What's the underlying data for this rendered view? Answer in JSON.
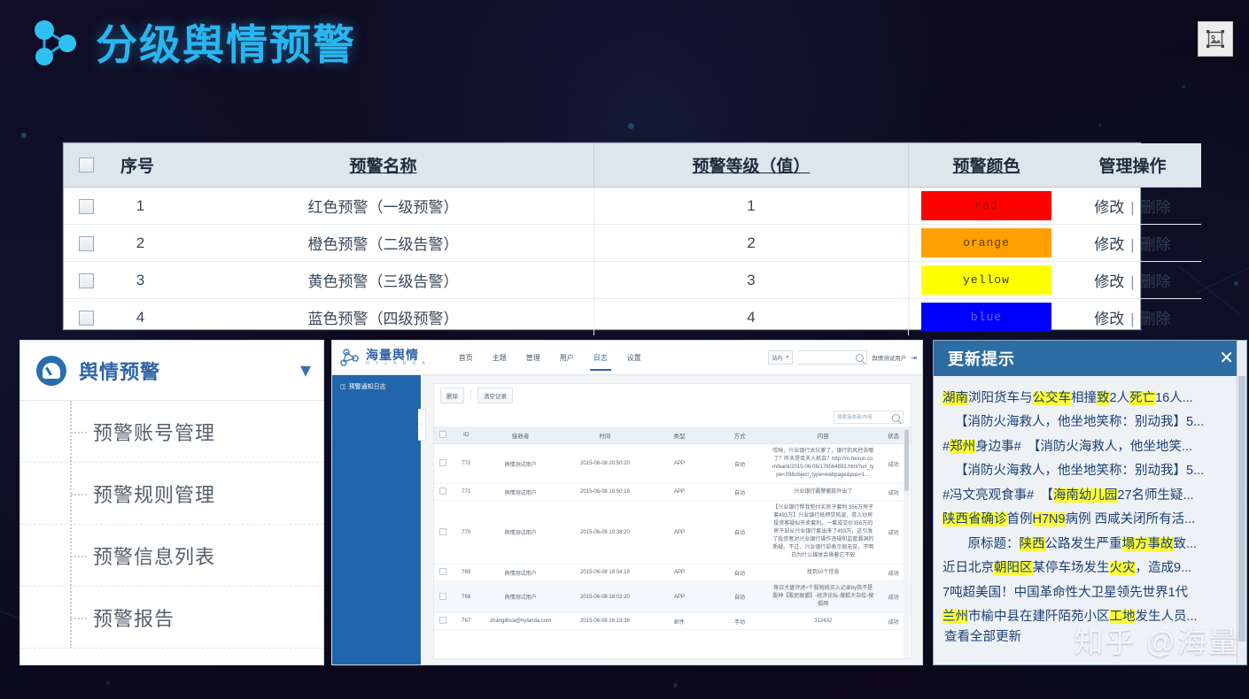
{
  "header": {
    "title": "分级舆情预警",
    "logo_icon": "network-nodes-icon",
    "image_placeholder_icon": "broken-image-icon"
  },
  "warning_table": {
    "columns": [
      {
        "key": "checkbox",
        "label": ""
      },
      {
        "key": "index",
        "label": "序号"
      },
      {
        "key": "name",
        "label": "预警名称"
      },
      {
        "key": "level",
        "label": "预警等级（值）"
      },
      {
        "key": "color",
        "label": "预警颜色"
      },
      {
        "key": "actions",
        "label": "管理操作"
      }
    ],
    "rows": [
      {
        "index": "1",
        "name": "红色预警（一级预警）",
        "level": "1",
        "color_label": "red",
        "color_hex": "#FF0000",
        "color_text": "#8a1a1a",
        "edit": "修改",
        "sep": "|",
        "delete": "删除"
      },
      {
        "index": "2",
        "name": "橙色预警（二级告警）",
        "level": "2",
        "color_label": "orange",
        "color_hex": "#FFA000",
        "color_text": "#5c3c00",
        "edit": "修改",
        "sep": "|",
        "delete": "删除"
      },
      {
        "index": "3",
        "name": "黄色预警（三级告警）",
        "level": "3",
        "color_label": "yellow",
        "color_hex": "#FFFF00",
        "color_text": "#3c3c00",
        "edit": "修改",
        "sep": "|",
        "delete": "删除"
      },
      {
        "index": "4",
        "name": "蓝色预警（四级预警）",
        "level": "4",
        "color_label": "blue",
        "color_hex": "#0000FF",
        "color_text": "#6a6ad0",
        "edit": "修改",
        "sep": "|",
        "delete": "删除"
      }
    ]
  },
  "sidebar_shot": {
    "title": "舆情预警",
    "gauge_icon": "gauge-icon",
    "chevron_icon": "chevron-down-icon",
    "items": [
      {
        "label": "预警账号管理"
      },
      {
        "label": "预警规则管理"
      },
      {
        "label": "预警信息列表"
      },
      {
        "label": "预警报告"
      }
    ]
  },
  "app_shot": {
    "logo_cn": "海量舆情",
    "logo_en": "H Y L A N D A",
    "nav": [
      {
        "label": "首页",
        "active": false
      },
      {
        "label": "主题",
        "active": false
      },
      {
        "label": "管理",
        "active": false
      },
      {
        "label": "用户",
        "active": false
      },
      {
        "label": "日志",
        "active": true
      },
      {
        "label": "设置",
        "active": false
      }
    ],
    "scope_select": "站内",
    "top_search_placeholder": "",
    "username": "舆情测试用户",
    "logout_icon": "logout-icon",
    "left_nav_item": "预警通知日志",
    "left_nav_icon": "log-icon",
    "collapse_icon": "chevron-left-icon",
    "toolbar": {
      "delete_label": "删除",
      "clear_label": "清空记录"
    },
    "search_placeholder": "搜索接收者/内容",
    "table": {
      "columns": [
        "ID",
        "接收者",
        "时间",
        "类型",
        "方式",
        "内容",
        "状态"
      ],
      "rows": [
        {
          "id": "772",
          "receiver": "舆情测试用户",
          "time": "2015-06-08 20:50:20",
          "type": "APP",
          "way": "自动",
          "content": "哎呦，兴业银行太坑爹了，银行的风控去哪了？昨天是否天人机会？http://m.hexun.com/bank/2015-06-08/176564893.html?url_type=39&object_type=webpage&pos=1…",
          "status": "成功"
        },
        {
          "id": "771",
          "receiver": "舆情测试用户",
          "time": "2015-06-08 19:50:19",
          "type": "APP",
          "way": "自动",
          "content": "兴业银行霸警撤款外出了",
          "status": "成功"
        },
        {
          "id": "770",
          "receiver": "舆情测试用户",
          "time": "2015-06-08 19:38:20",
          "type": "APP",
          "way": "自动",
          "content": "【兴业银行帮我垫付买房子套利 356万房子套493万】兴业银行抵押贷风波，卷入炒房投资客疑似天卖套利。一套成交价356万的房子却从兴业银行套出来了493万，这引发了投资者对兴业银行操作违规和监管漏洞的质疑。不过，兴业银行却表示很无奈，不明白为什么媒体会揪着它不放",
          "status": "成功"
        },
        {
          "id": "769",
          "receiver": "舆情测试用户",
          "time": "2015-06-08 18:54:19",
          "type": "APP",
          "way": "自动",
          "content": "找到10个信息",
          "status": "成功"
        },
        {
          "id": "768",
          "receiver": "舆情测试用户",
          "time": "2015-06-08 18:02:20",
          "type": "APP",
          "way": "自动",
          "content": "每日大盘评述+个股短线买入记录by我不是股神【股民联盟】-经济论坛-搜狐大杂烩-搜狐网",
          "status": "成功"
        },
        {
          "id": "767",
          "receiver": "zhanglihua@hylanda.com",
          "time": "2015-06-08 16:19:36",
          "type": "邮件",
          "way": "手动",
          "content": "312432",
          "status": "成功"
        }
      ]
    }
  },
  "update_popup": {
    "title": "更新提示",
    "close_icon": "close-icon",
    "more_link": "查看全部更新",
    "items": [
      {
        "indent": false,
        "parts": [
          {
            "t": "湖南",
            "h": true
          },
          {
            "t": "浏阳货车与",
            "h": false
          },
          {
            "t": "公交车",
            "h": true
          },
          {
            "t": "相撞",
            "h": false
          },
          {
            "t": "致",
            "h": true
          },
          {
            "t": "2人",
            "h": false
          },
          {
            "t": "死亡",
            "h": true
          },
          {
            "t": "16人...",
            "h": false
          }
        ]
      },
      {
        "indent": true,
        "parts": [
          {
            "t": "【消防火海救人，他坐地笑称：别动我】5...",
            "h": false
          }
        ]
      },
      {
        "indent": false,
        "parts": [
          {
            "t": "#",
            "h": false
          },
          {
            "t": "郑州",
            "h": true
          },
          {
            "t": "身边事#　【消防火海救人，他坐地笑...",
            "h": false
          }
        ]
      },
      {
        "indent": true,
        "parts": [
          {
            "t": "【消防火海救人，他坐地笑称：别动我】5...",
            "h": false
          }
        ]
      },
      {
        "indent": false,
        "parts": [
          {
            "t": "#冯文亮观食事#　【",
            "h": false
          },
          {
            "t": "海南幼儿园",
            "h": true
          },
          {
            "t": "27名师生疑...",
            "h": false
          }
        ]
      },
      {
        "indent": false,
        "parts": [
          {
            "t": "陕西省",
            "h": true
          },
          {
            "t": "确诊",
            "h": true
          },
          {
            "t": "首例",
            "h": false
          },
          {
            "t": "H7N9",
            "h": true
          },
          {
            "t": "病例 西咸关闭所有活...",
            "h": false
          }
        ]
      },
      {
        "indent": true,
        "parts": [
          {
            "t": "　原标题：",
            "h": false
          },
          {
            "t": "陕西",
            "h": true
          },
          {
            "t": "公路发生严重",
            "h": false
          },
          {
            "t": "塌方事故",
            "h": true
          },
          {
            "t": "致...",
            "h": false
          }
        ]
      },
      {
        "indent": false,
        "parts": [
          {
            "t": "近日北京",
            "h": false
          },
          {
            "t": "朝阳区",
            "h": true
          },
          {
            "t": "某停车场发生",
            "h": false
          },
          {
            "t": "火灾",
            "h": true
          },
          {
            "t": "，造成9...",
            "h": false
          }
        ]
      },
      {
        "indent": false,
        "parts": [
          {
            "t": "7吨超美国！中国革命性大卫星领先世界1代",
            "h": false
          }
        ]
      },
      {
        "indent": false,
        "parts": [
          {
            "t": "兰州",
            "h": true
          },
          {
            "t": "市榆中县在建阡陌苑小区",
            "h": false
          },
          {
            "t": "工地",
            "h": true
          },
          {
            "t": "发生人员...",
            "h": false
          }
        ]
      }
    ]
  },
  "watermark": "知乎 @海量"
}
